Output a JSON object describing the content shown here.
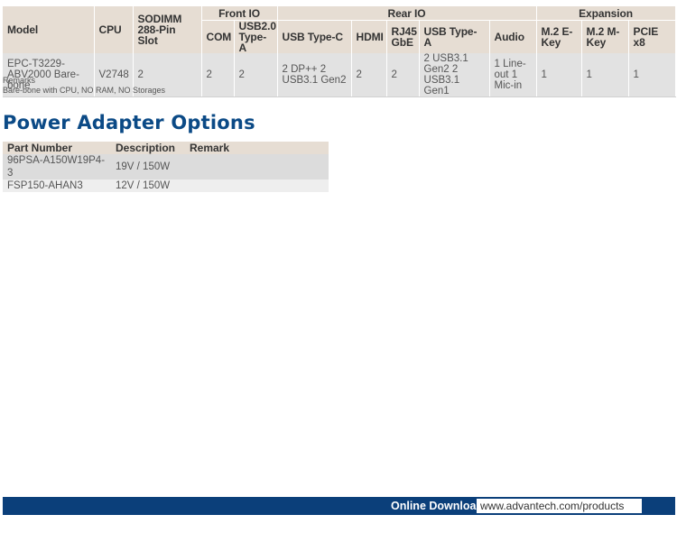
{
  "order_table": {
    "group_headers": {
      "front_io": "Front IO",
      "rear_io": "Rear IO",
      "expansion": "Expansion"
    },
    "columns": {
      "model": "Model",
      "cpu": "CPU",
      "sodimm": "SODIMM 288-Pin Slot",
      "com": "COM",
      "usb20": "USB2.0 Type-A",
      "usbc": "USB Type-C",
      "hdmi": "HDMI",
      "rj45": "RJ45 GbE",
      "usba": "USB Type-A",
      "audio": "Audio",
      "m2e": "M.2 E-Key",
      "m2m": "M.2 M-Key",
      "pcie": "PCIE x8"
    },
    "rows": [
      {
        "model": "EPC-T3229-ABV2000 Bare-bone",
        "cpu": "V2748",
        "sodimm": "2",
        "com": "2",
        "usb20": "2",
        "usbc": "2 DP++ 2 USB3.1 Gen2",
        "hdmi": "2",
        "rj45": "2",
        "usba": "2 USB3.1 Gen2 2 USB3.1 Gen1",
        "audio": "1 Line-out 1 Mic-in",
        "m2e": "1",
        "m2m": "1",
        "pcie": "1"
      }
    ]
  },
  "remarks": {
    "label": "Remarks",
    "text": "Bare-bone with CPU, NO RAM, NO Storages"
  },
  "power_section": {
    "title": "Power Adapter Options",
    "columns": [
      "Part Number",
      "Description",
      "Remark"
    ],
    "rows": [
      {
        "part_number": "96PSA-A150W19P4-3",
        "description": "19V / 150W",
        "remark": ""
      },
      {
        "part_number": "FSP150-AHAN3",
        "description": "12V / 150W",
        "remark": ""
      }
    ]
  },
  "footer": {
    "label": "Online Download",
    "link": "www.advantech.com/products"
  },
  "colors": {
    "brand_blue": "#0b3f7a",
    "title_blue": "#0b4a86",
    "header_beige": "#e6ddd3",
    "row_gray": "#e2e2e2"
  }
}
